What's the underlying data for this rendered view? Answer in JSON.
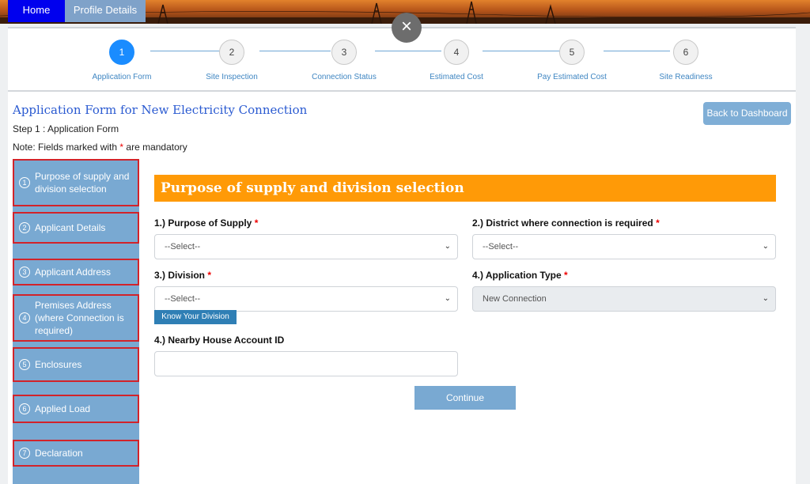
{
  "nav": {
    "home": "Home",
    "profile": "Profile Details"
  },
  "close_glyph": "×",
  "stepper": {
    "steps": [
      {
        "number": "1",
        "label": "Application Form"
      },
      {
        "number": "2",
        "label": "Site Inspection"
      },
      {
        "number": "3",
        "label": "Connection Status"
      },
      {
        "number": "4",
        "label": "Estimated Cost"
      },
      {
        "number": "5",
        "label": "Pay Estimated Cost"
      },
      {
        "number": "6",
        "label": "Site Readiness"
      }
    ],
    "active_step": 1
  },
  "header": {
    "title": "Application Form for New Electricity Connection",
    "step": "Step 1 : Application Form",
    "note_prefix": "Note: Fields marked with ",
    "note_star": "*",
    "note_suffix": " are mandatory",
    "back_button": "Back to Dashboard"
  },
  "sidebar": {
    "items": [
      {
        "num": "1",
        "label": "Purpose of supply and division selection"
      },
      {
        "num": "2",
        "label": "Applicant Details"
      },
      {
        "num": "3",
        "label": "Applicant Address"
      },
      {
        "num": "4",
        "label": "Premises Address (where Connection is required)"
      },
      {
        "num": "5",
        "label": "Enclosures"
      },
      {
        "num": "6",
        "label": "Applied Load"
      },
      {
        "num": "7",
        "label": "Declaration"
      }
    ]
  },
  "form": {
    "section_title": "Purpose of supply and division selection",
    "required_mark": "*",
    "purpose": {
      "label": "1.) Purpose of Supply ",
      "value": "--Select--"
    },
    "district": {
      "label": "2.) District where connection is required ",
      "value": "--Select--"
    },
    "division": {
      "label": "3.) Division ",
      "value": "--Select--"
    },
    "app_type": {
      "label": "4.) Application Type ",
      "value": "New Connection"
    },
    "know_division": "Know Your Division",
    "house_account": {
      "label": "4.) Nearby House Account ID",
      "value": ""
    },
    "continue": "Continue"
  },
  "colors": {
    "accent_orange": "#ff9a07",
    "menu_blue": "#79a9d2",
    "active_step": "#1a8cff",
    "home_blue": "#0000ee",
    "required_red": "#e00000"
  }
}
